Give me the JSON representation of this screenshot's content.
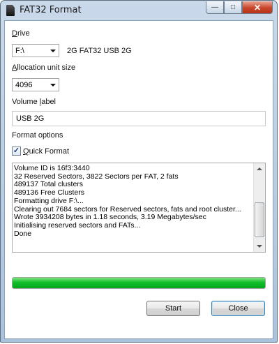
{
  "window": {
    "title": "FAT32 Format"
  },
  "caption_buttons": {
    "minimize": "—",
    "maximize": "□",
    "close": "✕"
  },
  "drive": {
    "label_first": "D",
    "label_rest": "rive",
    "value": "F:\\",
    "info": "2G FAT32 USB 2G"
  },
  "allocation": {
    "label_first": "A",
    "label_rest": "llocation unit size",
    "value": "4096"
  },
  "volume": {
    "label_pre": "Volume ",
    "label_first": "l",
    "label_rest": "abel",
    "value": "USB 2G"
  },
  "format_options": {
    "label": "Format options",
    "quick_format_first": "Q",
    "quick_format_rest": "uick Format",
    "quick_format_checked": true
  },
  "log": {
    "lines": [
      "Volume ID is 16f3:3440",
      "32 Reserved Sectors, 3822 Sectors per FAT, 2 fats",
      "489137 Total clusters",
      "489136 Free Clusters",
      "Formatting drive F:\\...",
      "Clearing out 7684 sectors for Reserved sectors, fats and root cluster...",
      "Wrote 3934208 bytes in 1.18 seconds, 3.19 Megabytes/sec",
      "Initialising reserved sectors and FATs...",
      "Done"
    ]
  },
  "progress": {
    "percent": 100,
    "color": "#10c22c"
  },
  "buttons": {
    "start": "Start",
    "close": "Close"
  }
}
